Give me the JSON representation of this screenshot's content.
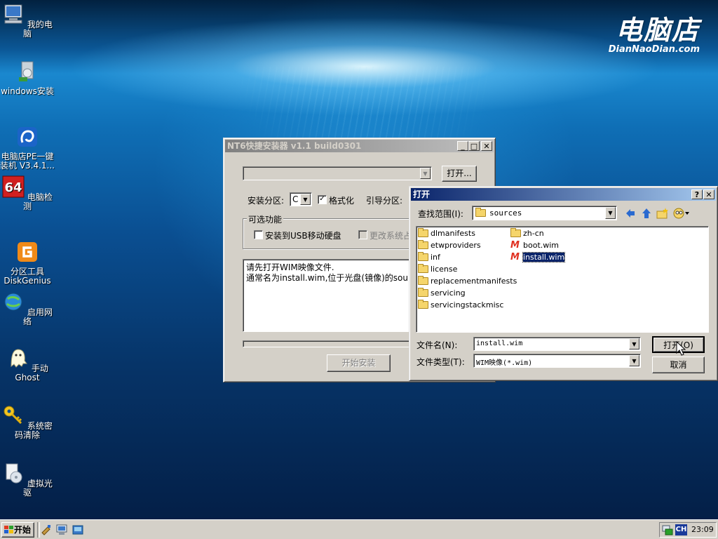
{
  "desktop": {
    "logo": {
      "cn": "电脑店",
      "en": "DianNaoDian.com"
    },
    "icons": [
      {
        "label": "我的电脑",
        "icon": "computer-icon"
      },
      {
        "label": "windows安装",
        "icon": "windows-install-icon"
      },
      {
        "label": "电脑店PE一键\n装机 V3.4.1...",
        "icon": "pe-install-icon"
      },
      {
        "label": "电脑检测",
        "icon": "64-detect-icon"
      },
      {
        "label": "分区工具\nDiskGenius",
        "icon": "diskgenius-icon"
      },
      {
        "label": "启用网络",
        "icon": "network-icon"
      },
      {
        "label": "手动Ghost",
        "icon": "ghost-icon"
      },
      {
        "label": "系统密码清除",
        "icon": "key-icon"
      },
      {
        "label": "虚拟光驱",
        "icon": "virtual-drive-icon"
      }
    ]
  },
  "nt6": {
    "title": "NT6快捷安装器 v1.1 build0301",
    "open_btn": "打开...",
    "install_partition_label": "安装分区:",
    "install_partition_value": "C",
    "format_label": "格式化",
    "format_checked": true,
    "boot_partition_label": "引导分区:",
    "optional_group": "可选功能",
    "usb_label": "安装到USB移动硬盘",
    "change_label": "更改系统占",
    "message_line1": "请先打开WIM映像文件.",
    "message_line2": "通常名为install.wim,位于光盘(镜像)的sources",
    "start_btn": "开始安装"
  },
  "open_dialog": {
    "title": "打开",
    "lookin_label": "查找范围(I):",
    "lookin_value": "sources",
    "files_col1": [
      {
        "name": "dlmanifests",
        "type": "folder"
      },
      {
        "name": "etwproviders",
        "type": "folder"
      },
      {
        "name": "inf",
        "type": "folder"
      },
      {
        "name": "license",
        "type": "folder"
      },
      {
        "name": "replacementmanifests",
        "type": "folder"
      },
      {
        "name": "servicing",
        "type": "folder"
      },
      {
        "name": "servicingstackmisc",
        "type": "folder"
      }
    ],
    "files_col2": [
      {
        "name": "zh-cn",
        "type": "folder"
      },
      {
        "name": "boot.wim",
        "type": "wim"
      },
      {
        "name": "install.wim",
        "type": "wim",
        "selected": true
      }
    ],
    "filename_label": "文件名(N):",
    "filename_value": "install.wim",
    "filetype_label": "文件类型(T):",
    "filetype_value": "WIM映像(*.wim)",
    "open_btn": "打开(O)",
    "cancel_btn": "取消"
  },
  "taskbar": {
    "start_label": "开始",
    "lang": "CH",
    "clock": "23:09"
  }
}
